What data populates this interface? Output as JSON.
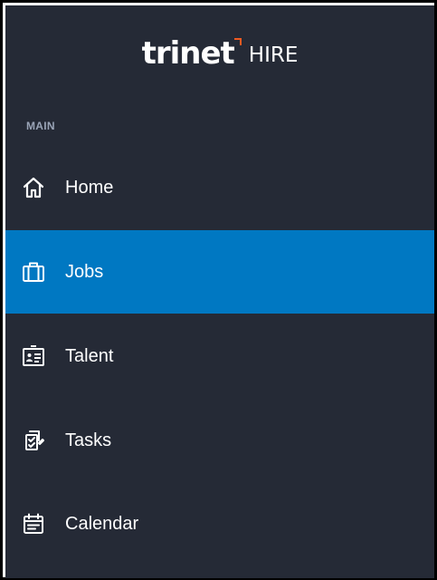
{
  "brand": {
    "wordmark": "trinet",
    "suffix": "HIRE",
    "accent_color": "#f05a22"
  },
  "sidebar": {
    "background_color": "#252a36",
    "active_color": "#0078c2",
    "section_label": "MAIN",
    "items": [
      {
        "label": "Home",
        "icon": "home-icon",
        "active": false
      },
      {
        "label": "Jobs",
        "icon": "briefcase-icon",
        "active": true
      },
      {
        "label": "Talent",
        "icon": "id-card-icon",
        "active": false
      },
      {
        "label": "Tasks",
        "icon": "tasks-icon",
        "active": false
      },
      {
        "label": "Calendar",
        "icon": "calendar-icon",
        "active": false
      }
    ]
  }
}
